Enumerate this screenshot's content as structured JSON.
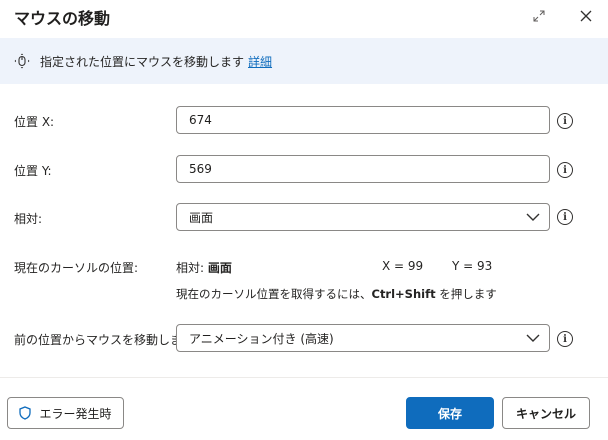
{
  "dialog": {
    "title": "マウスの移動"
  },
  "banner": {
    "text": "指定された位置にマウスを移動します",
    "link": "詳細",
    "icon": "mouse-move-icon"
  },
  "fields": {
    "x_label": "位置 X:",
    "x_value": "674",
    "y_label": "位置 Y:",
    "y_value": "569",
    "relative_label": "相対:",
    "relative_value": "画面",
    "motion_label": "前の位置からマウスを移動します:",
    "motion_value": "アニメーション付き (高速)"
  },
  "cursor": {
    "label": "現在のカーソルの位置:",
    "relative_prefix": "相対:",
    "relative_value": "画面",
    "x_readout": "X = 99",
    "y_readout": "Y = 93",
    "hint_prefix": "現在のカーソル位置を取得するには、",
    "hint_keys": "Ctrl+Shift",
    "hint_suffix": " を押します"
  },
  "footer": {
    "error_button": "エラー発生時",
    "save_button": "保存",
    "cancel_button": "キャンセル"
  },
  "colors": {
    "accent": "#0f6cbd",
    "banner_bg": "#eef3fb",
    "border": "#8a8886"
  }
}
